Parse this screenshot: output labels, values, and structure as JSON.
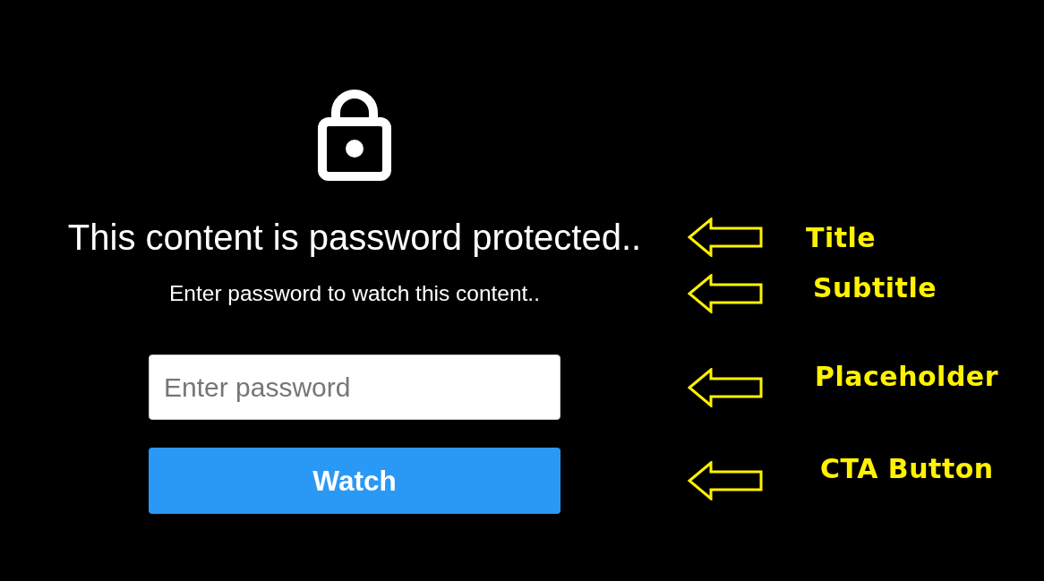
{
  "title": {
    "text": "This content is password protected..",
    "annotation": "Title"
  },
  "subtitle": {
    "text": "Enter password to watch this content..",
    "annotation": "Subtitle"
  },
  "password_field": {
    "placeholder": "Enter password",
    "annotation": "Placeholder"
  },
  "watch_button": {
    "label": "Watch",
    "annotation": "CTA Button"
  }
}
